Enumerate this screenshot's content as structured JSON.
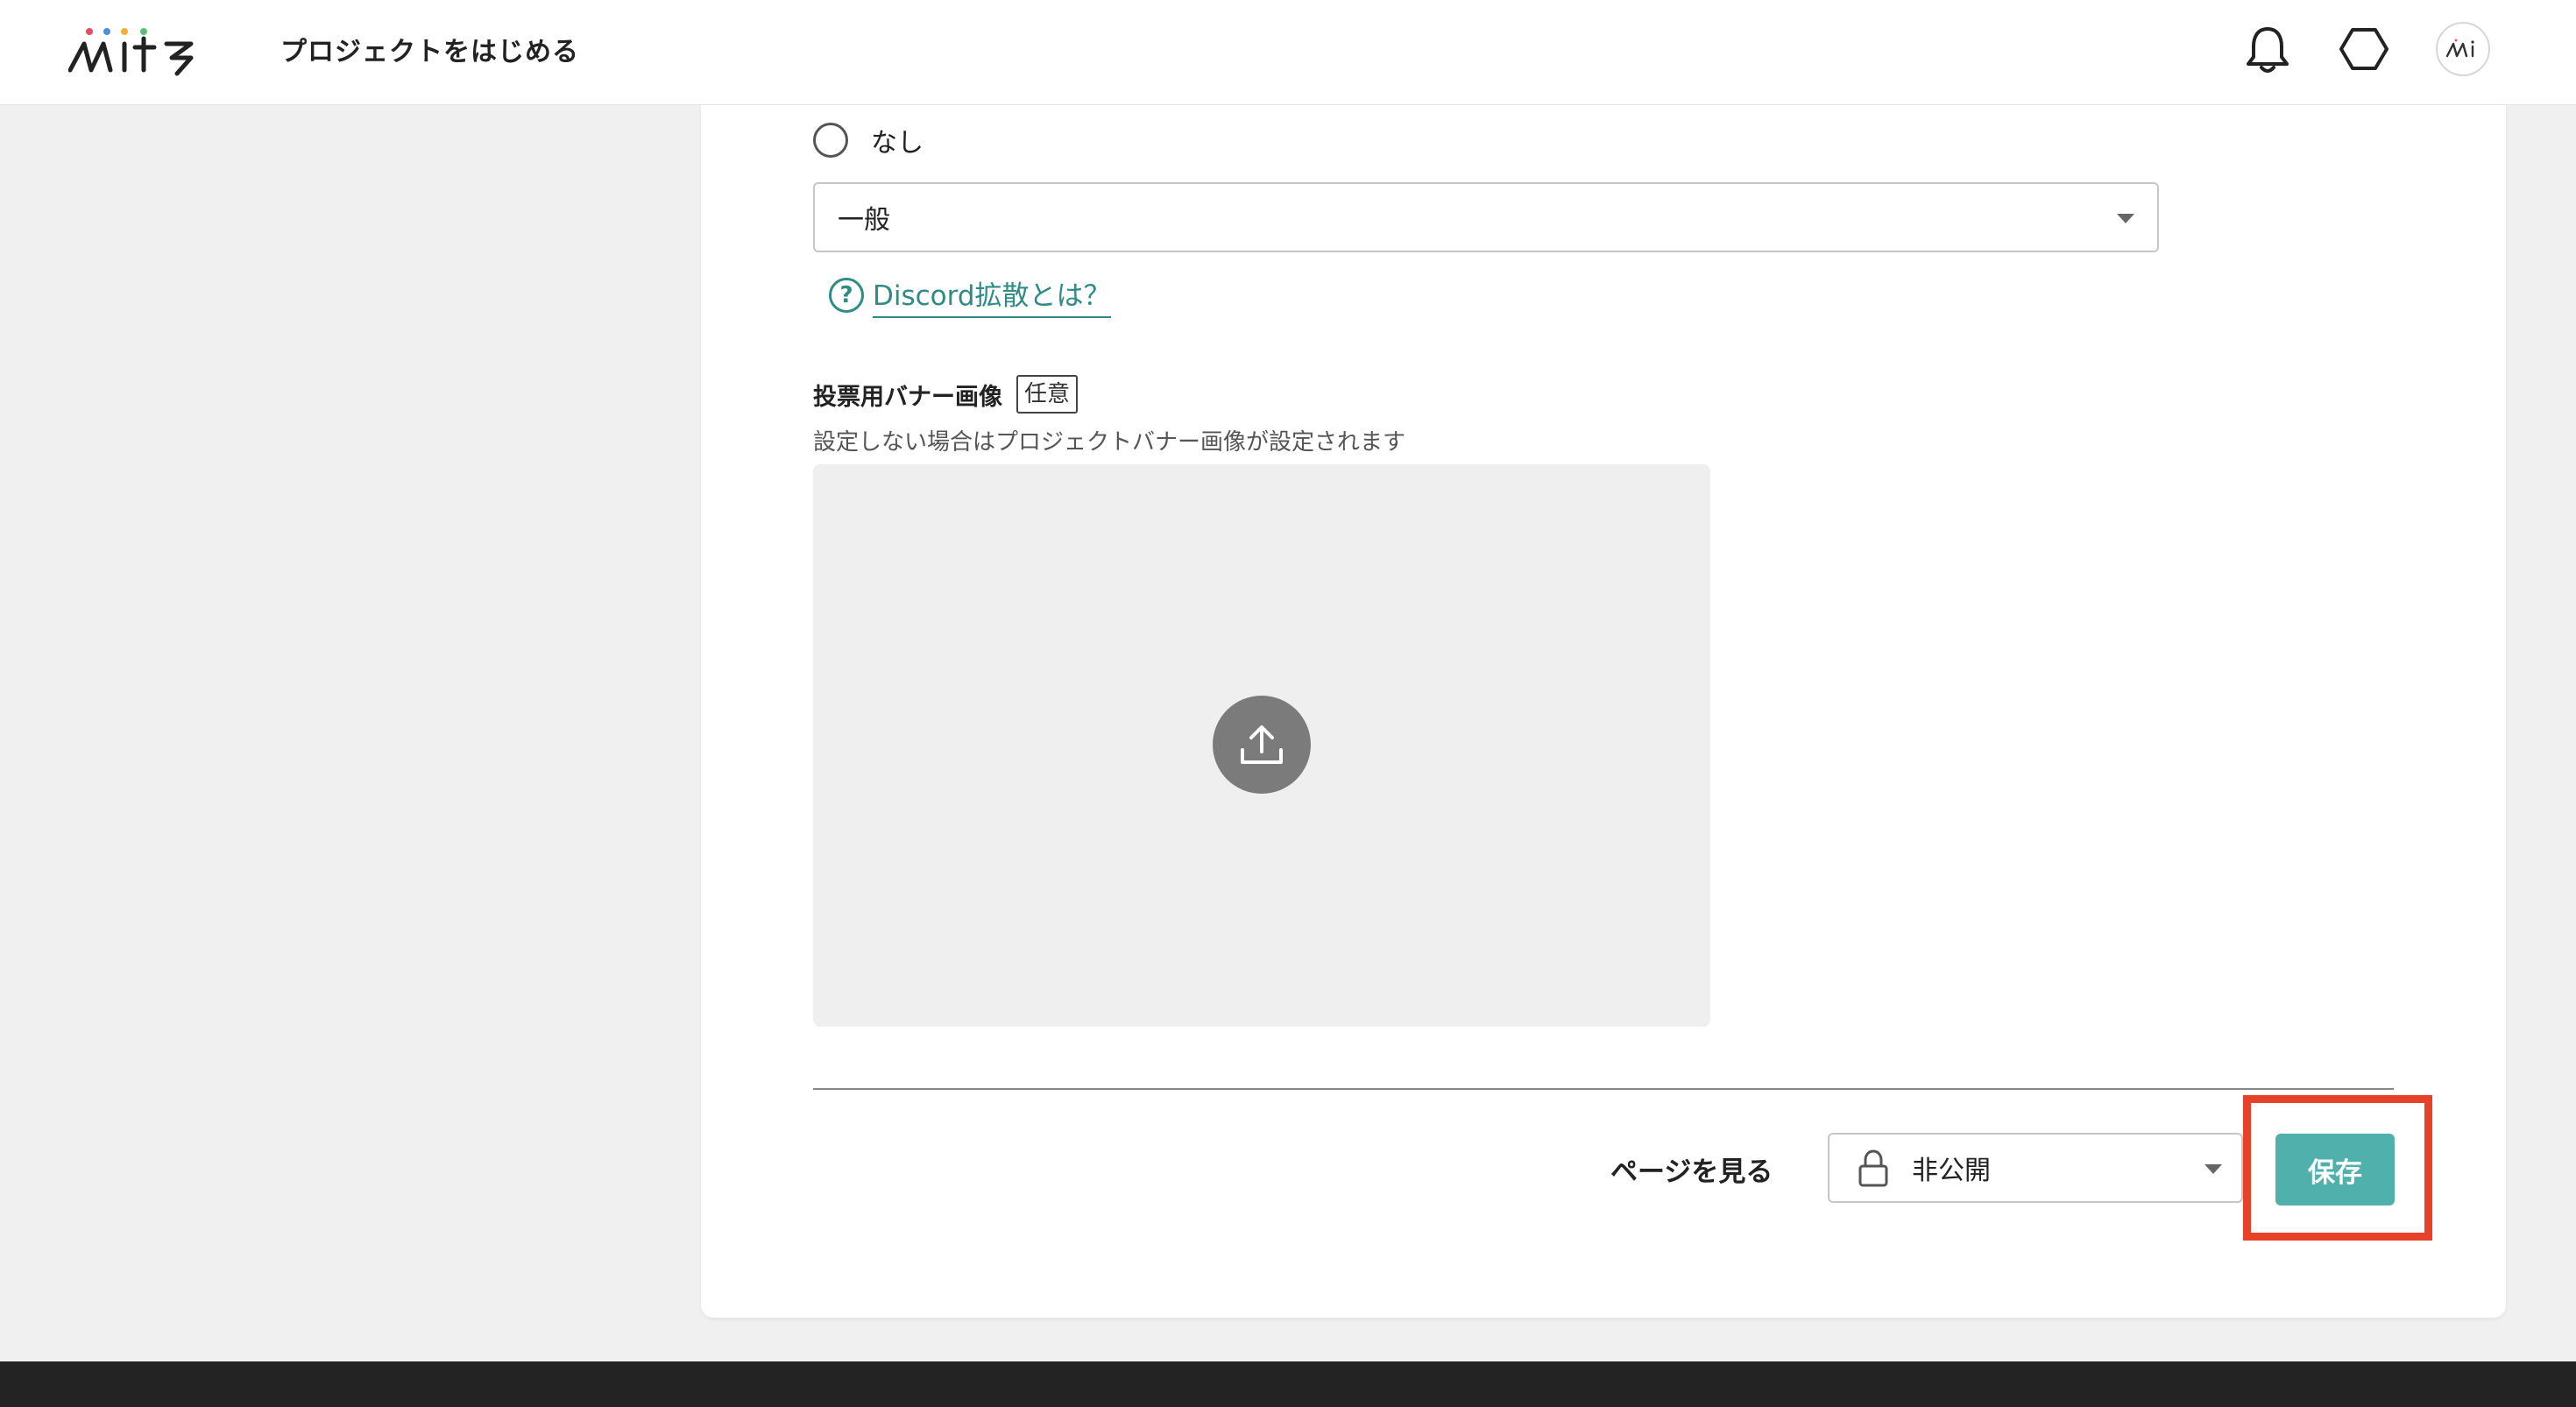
{
  "header": {
    "logo_text": "mits",
    "title": "プロジェクトをはじめる",
    "icons": [
      "bell-icon",
      "hexagon-icon"
    ],
    "avatar_text": "mi"
  },
  "form": {
    "radio_none_label": "なし",
    "channel_select_value": "一般",
    "help_link_icon": "?",
    "help_link_text": "Discord拡散とは？",
    "banner_label": "投票用バナー画像",
    "banner_optional": "任意",
    "banner_description": "設定しない場合はプロジェクトバナー画像が設定されます"
  },
  "actions": {
    "view_page_label": "ページを見る",
    "visibility_value": "非公開",
    "save_label": "保存"
  },
  "colors": {
    "accent": "#4fb0ac",
    "link": "#2e8b86",
    "highlight": "#e8412a",
    "footer": "#232323"
  }
}
